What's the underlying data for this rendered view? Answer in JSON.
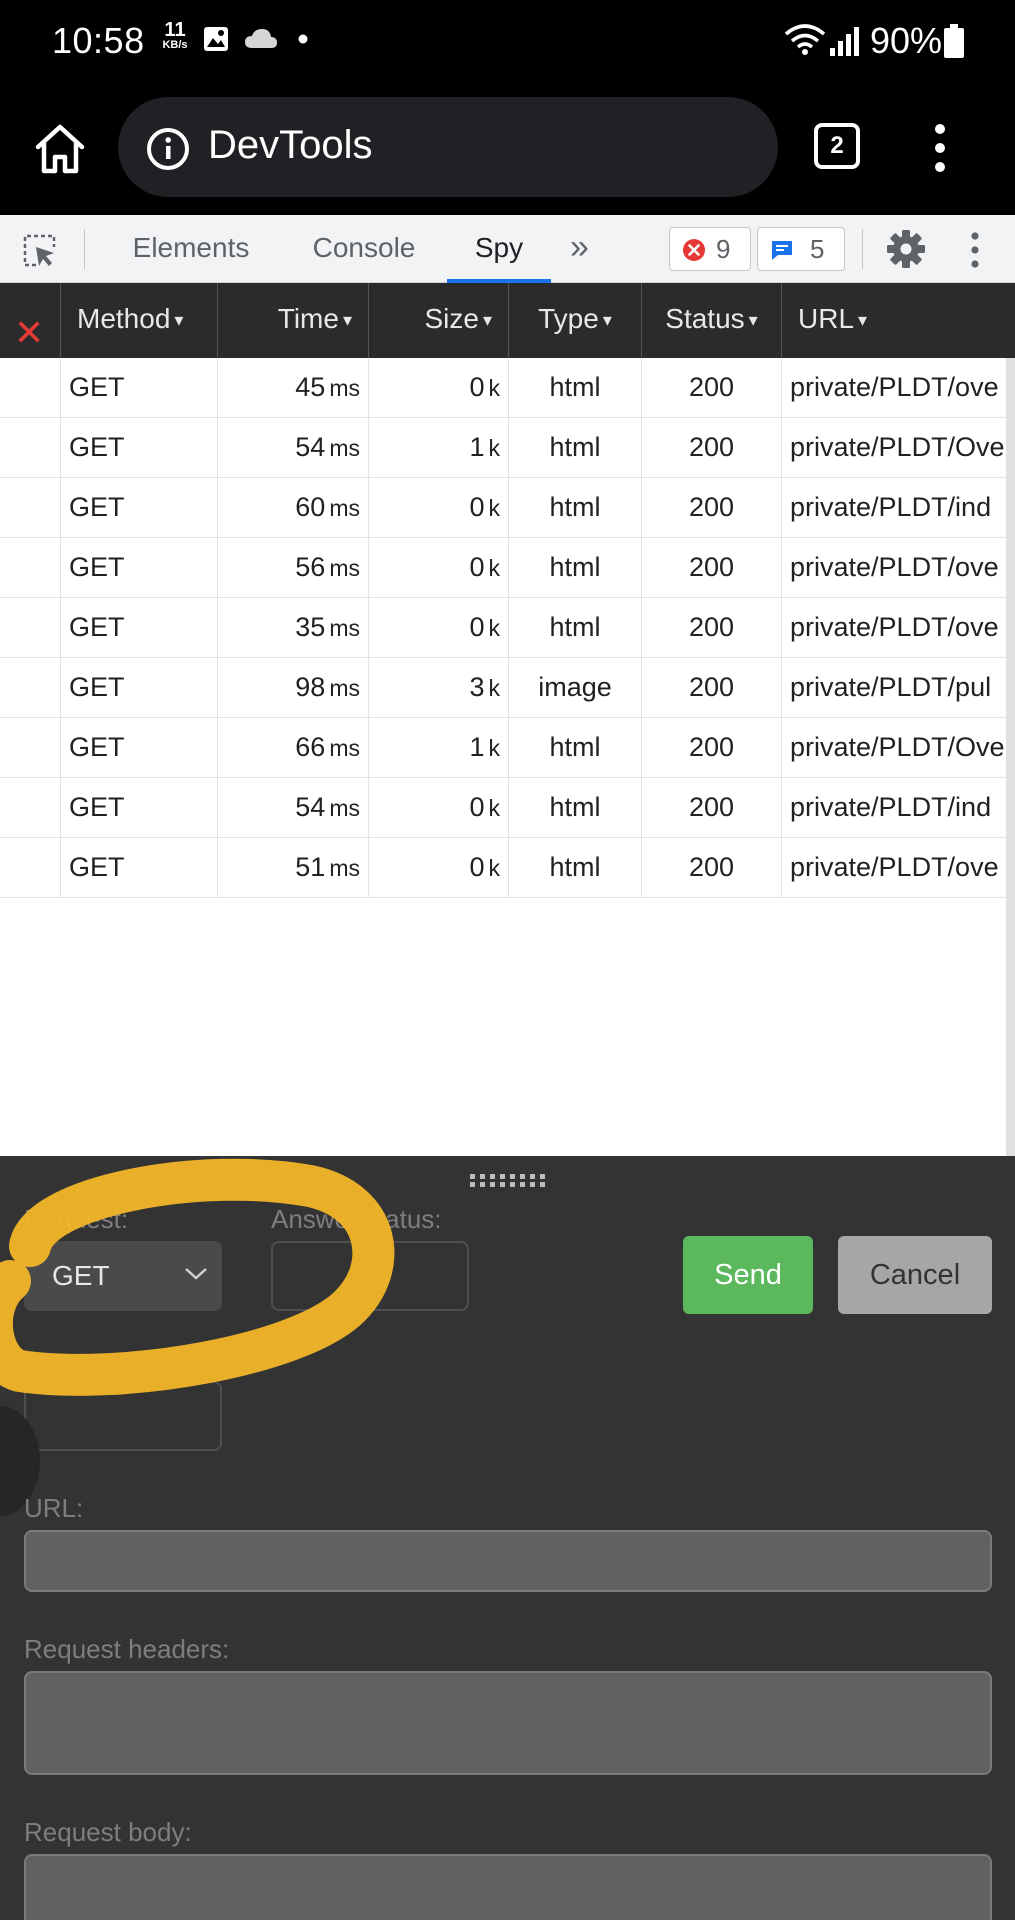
{
  "status_bar": {
    "time": "10:58",
    "net_speed_value": "11",
    "net_speed_unit": "KB/s",
    "battery": "90%"
  },
  "browser": {
    "page_title": "DevTools",
    "tab_count": "2"
  },
  "devtools": {
    "tabs": [
      "Elements",
      "Console",
      "Spy"
    ],
    "active_tab": "Spy",
    "more_tabs_glyph": "»",
    "error_count": "9",
    "message_count": "5",
    "error_color": "#e53935",
    "message_color": "#1a73e8"
  },
  "table": {
    "columns": [
      "Method",
      "Time",
      "Size",
      "Type",
      "Status",
      "URL"
    ],
    "sort_glyph": "▾",
    "clear_glyph": "✕",
    "time_unit": "ms",
    "size_unit": "k",
    "rows": [
      {
        "method": "GET",
        "time": "45",
        "size": "0",
        "type": "html",
        "status": "200",
        "url": "private/PLDT/ove"
      },
      {
        "method": "GET",
        "time": "54",
        "size": "1",
        "type": "html",
        "status": "200",
        "url": "private/PLDT/Ove"
      },
      {
        "method": "GET",
        "time": "60",
        "size": "0",
        "type": "html",
        "status": "200",
        "url": "private/PLDT/ind"
      },
      {
        "method": "GET",
        "time": "56",
        "size": "0",
        "type": "html",
        "status": "200",
        "url": "private/PLDT/ove"
      },
      {
        "method": "GET",
        "time": "35",
        "size": "0",
        "type": "html",
        "status": "200",
        "url": "private/PLDT/ove"
      },
      {
        "method": "GET",
        "time": "98",
        "size": "3",
        "type": "image",
        "status": "200",
        "url": "private/PLDT/pul"
      },
      {
        "method": "GET",
        "time": "66",
        "size": "1",
        "type": "html",
        "status": "200",
        "url": "private/PLDT/Ove"
      },
      {
        "method": "GET",
        "time": "54",
        "size": "0",
        "type": "html",
        "status": "200",
        "url": "private/PLDT/ind"
      },
      {
        "method": "GET",
        "time": "51",
        "size": "0",
        "type": "html",
        "status": "200",
        "url": "private/PLDT/ove"
      }
    ]
  },
  "request_panel": {
    "request_label": "Request:",
    "answer_status_label": "Answer status:",
    "method_value": "GET",
    "send_label": "Send",
    "cancel_label": "Cancel",
    "url_label": "URL:",
    "headers_label": "Request headers:",
    "body_label": "Request body:",
    "send_color": "#5cb85c",
    "highlight_color": "#f0b429"
  }
}
